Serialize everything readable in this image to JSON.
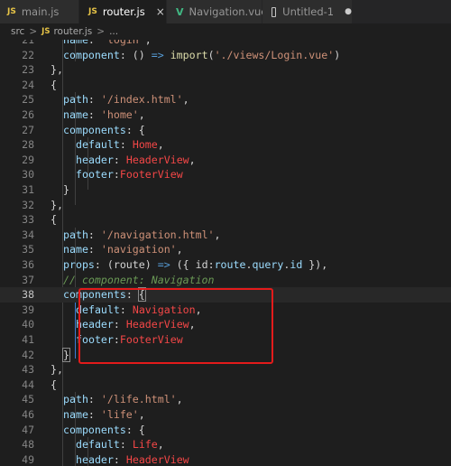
{
  "tabs": [
    {
      "label": "main.js",
      "icon": "js-file-icon",
      "badge": "JS",
      "active": false
    },
    {
      "label": "router.js",
      "icon": "js-file-icon",
      "badge": "JS",
      "active": true,
      "close": "×"
    },
    {
      "label": "Navigation.vue",
      "icon": "vue-file-icon",
      "badge": "V",
      "active": false
    },
    {
      "label": "Untitled-1",
      "icon": "file-icon",
      "active": false,
      "modified": "●"
    }
  ],
  "breadcrumb": {
    "folder": "src",
    "sep": ">",
    "badge": "JS",
    "file": "router.js",
    "more": "..."
  },
  "editor": {
    "current_line": 38,
    "lines": [
      {
        "n": "21",
        "tokens": [
          [
            "k",
            "name"
          ],
          [
            "p",
            ": "
          ],
          [
            "s",
            "'login'"
          ],
          [
            "p",
            ","
          ]
        ]
      },
      {
        "n": "22",
        "tokens": [
          [
            "k",
            "component"
          ],
          [
            "p",
            ": () "
          ],
          [
            "b",
            "=>"
          ],
          [
            "p",
            " "
          ],
          [
            "f",
            "import"
          ],
          [
            "p",
            "("
          ],
          [
            "s",
            "'./views/Login.vue'"
          ],
          [
            "p",
            ")"
          ]
        ]
      },
      {
        "n": "23",
        "tokens": [
          [
            "p",
            "},"
          ]
        ]
      },
      {
        "n": "24",
        "tokens": [
          [
            "p",
            "{"
          ]
        ]
      },
      {
        "n": "25",
        "tokens": [
          [
            "k",
            "path"
          ],
          [
            "p",
            ": "
          ],
          [
            "s",
            "'/index.html'"
          ],
          [
            "p",
            ","
          ]
        ]
      },
      {
        "n": "26",
        "tokens": [
          [
            "k",
            "name"
          ],
          [
            "p",
            ": "
          ],
          [
            "s",
            "'home'"
          ],
          [
            "p",
            ","
          ]
        ]
      },
      {
        "n": "27",
        "tokens": [
          [
            "k",
            "components"
          ],
          [
            "p",
            ": {"
          ]
        ]
      },
      {
        "n": "28",
        "tokens": [
          [
            "k",
            "default"
          ],
          [
            "p",
            ": "
          ],
          [
            "v",
            "Home"
          ],
          [
            "p",
            ","
          ]
        ]
      },
      {
        "n": "29",
        "tokens": [
          [
            "k",
            "header"
          ],
          [
            "p",
            ": "
          ],
          [
            "v",
            "HeaderView"
          ],
          [
            "p",
            ","
          ]
        ]
      },
      {
        "n": "30",
        "tokens": [
          [
            "k",
            "footer"
          ],
          [
            "p",
            ":"
          ],
          [
            "v",
            "FooterView"
          ]
        ]
      },
      {
        "n": "31",
        "tokens": [
          [
            "p",
            "}"
          ]
        ]
      },
      {
        "n": "32",
        "tokens": [
          [
            "p",
            "},"
          ]
        ]
      },
      {
        "n": "33",
        "tokens": [
          [
            "p",
            "{"
          ]
        ]
      },
      {
        "n": "34",
        "tokens": [
          [
            "k",
            "path"
          ],
          [
            "p",
            ": "
          ],
          [
            "s",
            "'/navigation.html'"
          ],
          [
            "p",
            ","
          ]
        ]
      },
      {
        "n": "35",
        "tokens": [
          [
            "k",
            "name"
          ],
          [
            "p",
            ": "
          ],
          [
            "s",
            "'navigation'"
          ],
          [
            "p",
            ","
          ]
        ]
      },
      {
        "n": "36",
        "tokens": [
          [
            "k",
            "props"
          ],
          [
            "p",
            ": (route) "
          ],
          [
            "b",
            "=>"
          ],
          [
            "p",
            " ({ id:"
          ],
          [
            "k",
            "route"
          ],
          [
            "p",
            "."
          ],
          [
            "k",
            "query"
          ],
          [
            "p",
            "."
          ],
          [
            "k",
            "id"
          ],
          [
            "p",
            " }),"
          ]
        ]
      },
      {
        "n": "37",
        "tokens": [
          [
            "c",
            "// component: Navigation"
          ]
        ]
      },
      {
        "n": "38",
        "tokens": [
          [
            "k",
            "components"
          ],
          [
            "p",
            ": "
          ],
          [
            "cur",
            "{"
          ]
        ]
      },
      {
        "n": "39",
        "tokens": [
          [
            "k",
            "default"
          ],
          [
            "p",
            ": "
          ],
          [
            "v",
            "Navigation"
          ],
          [
            "p",
            ","
          ]
        ]
      },
      {
        "n": "40",
        "tokens": [
          [
            "k",
            "header"
          ],
          [
            "p",
            ": "
          ],
          [
            "v",
            "HeaderView"
          ],
          [
            "p",
            ","
          ]
        ]
      },
      {
        "n": "41",
        "tokens": [
          [
            "k",
            "footer"
          ],
          [
            "p",
            ":"
          ],
          [
            "v",
            "FooterView"
          ]
        ]
      },
      {
        "n": "42",
        "tokens": [
          [
            "cur",
            "}"
          ]
        ]
      },
      {
        "n": "43",
        "tokens": [
          [
            "p",
            "},"
          ]
        ]
      },
      {
        "n": "44",
        "tokens": [
          [
            "p",
            "{"
          ]
        ]
      },
      {
        "n": "45",
        "tokens": [
          [
            "k",
            "path"
          ],
          [
            "p",
            ": "
          ],
          [
            "s",
            "'/life.html'"
          ],
          [
            "p",
            ","
          ]
        ]
      },
      {
        "n": "46",
        "tokens": [
          [
            "k",
            "name"
          ],
          [
            "p",
            ": "
          ],
          [
            "s",
            "'life'"
          ],
          [
            "p",
            ","
          ]
        ]
      },
      {
        "n": "47",
        "tokens": [
          [
            "k",
            "components"
          ],
          [
            "p",
            ": {"
          ]
        ]
      },
      {
        "n": "48",
        "tokens": [
          [
            "k",
            "default"
          ],
          [
            "p",
            ": "
          ],
          [
            "v",
            "Life"
          ],
          [
            "p",
            ","
          ]
        ]
      },
      {
        "n": "49",
        "tokens": [
          [
            "k",
            "header"
          ],
          [
            "p",
            ": "
          ],
          [
            "v",
            "HeaderView"
          ]
        ]
      }
    ]
  },
  "annotation": {
    "color": "#e31b1b",
    "target_lines": "38-42"
  }
}
